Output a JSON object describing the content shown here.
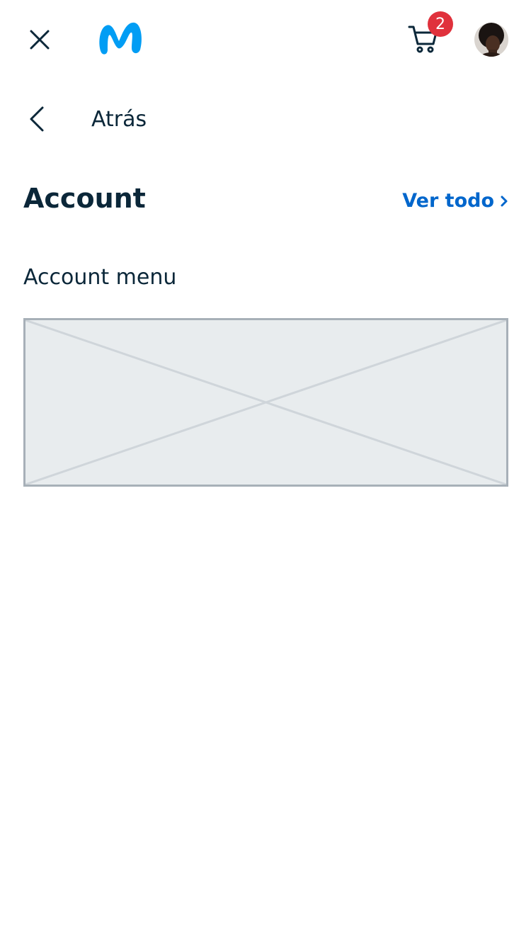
{
  "colors": {
    "brand": "#019df4",
    "text": "#0b2739",
    "link": "#0066cc",
    "badge": "#e0313c"
  },
  "topbar": {
    "close_icon": "close-icon",
    "logo_icon": "movistar-m-logo",
    "cart_icon": "cart-icon",
    "cart_count": "2",
    "avatar": "user-avatar"
  },
  "navigation": {
    "back_icon": "chevron-left-icon",
    "back_label": "Atrás"
  },
  "section": {
    "title": "Account",
    "see_all_label": "Ver todo",
    "see_all_icon": "chevron-right-icon",
    "subtitle": "Account menu",
    "placeholder_icon": "image-placeholder"
  }
}
